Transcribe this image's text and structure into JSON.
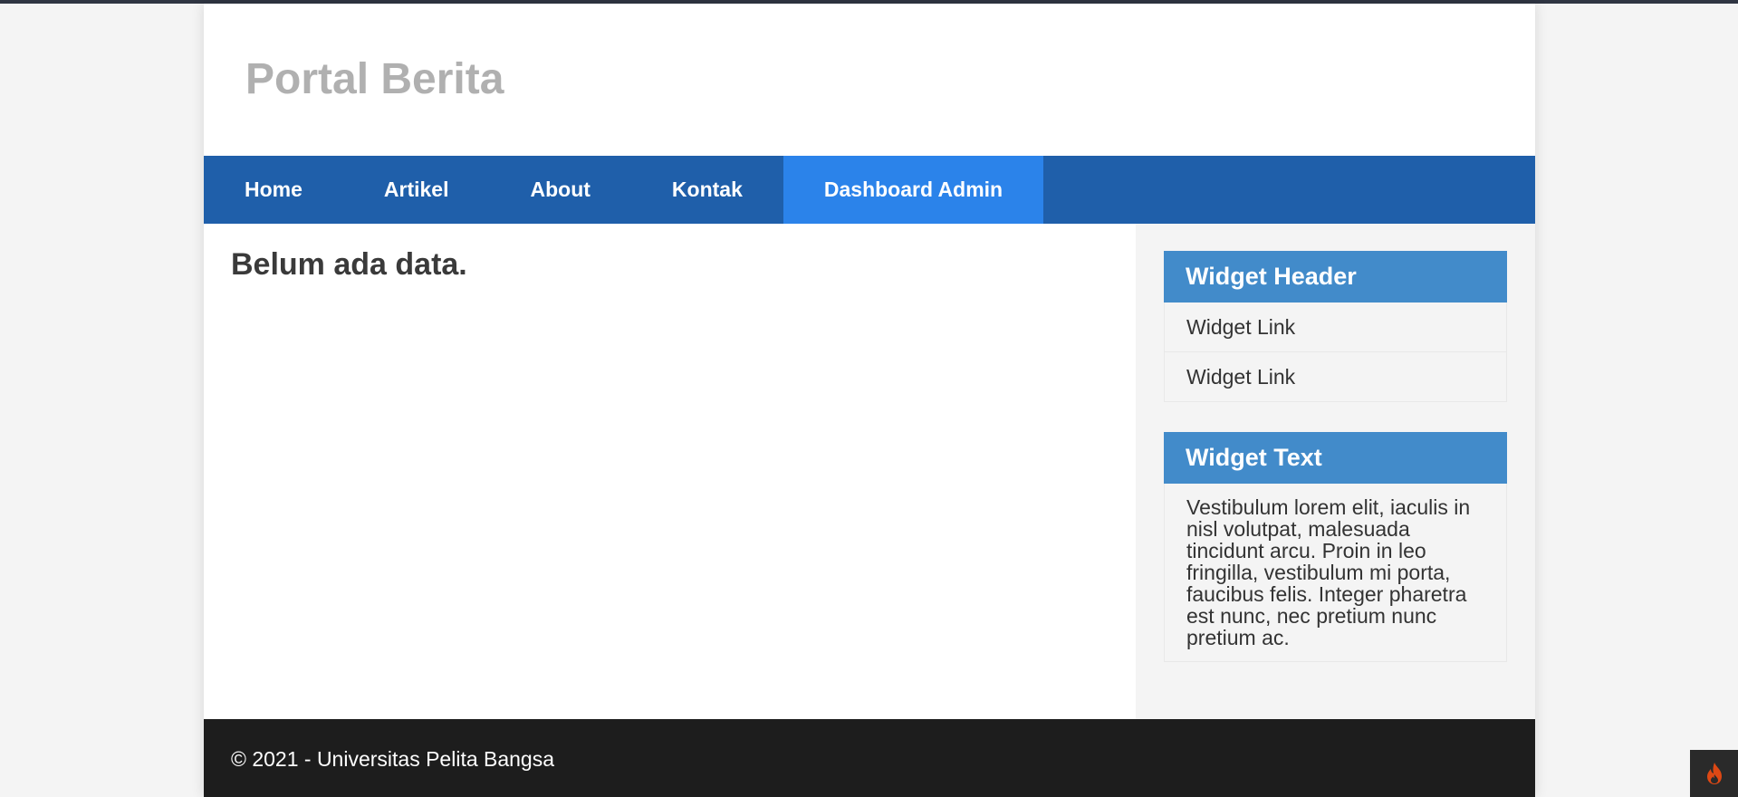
{
  "header": {
    "site_title": "Portal Berita"
  },
  "nav": {
    "items": [
      {
        "label": "Home"
      },
      {
        "label": "Artikel"
      },
      {
        "label": "About"
      },
      {
        "label": "Kontak"
      },
      {
        "label": "Dashboard Admin",
        "active": true
      }
    ]
  },
  "content": {
    "message": "Belum ada data."
  },
  "sidebar": {
    "widget_links": {
      "header": "Widget Header",
      "links": [
        "Widget Link",
        "Widget Link"
      ]
    },
    "widget_text": {
      "header": "Widget Text",
      "body": "Vestibulum lorem elit, iaculis in nisl volutpat, malesuada tincidunt arcu. Proin in leo fringilla, vestibulum mi porta, faucibus felis. Integer pharetra est nunc, nec pretium nunc pretium ac."
    }
  },
  "footer": {
    "text": "© 2021 - Universitas Pelita Bangsa"
  },
  "debug_toolbar": {
    "icon": "flame-icon"
  },
  "colors": {
    "nav_bg": "#1f5faa",
    "nav_active": "#2b83ea",
    "widget_header": "#428bca",
    "footer_bg": "#1d1d1d",
    "flame": "#dd4814"
  }
}
